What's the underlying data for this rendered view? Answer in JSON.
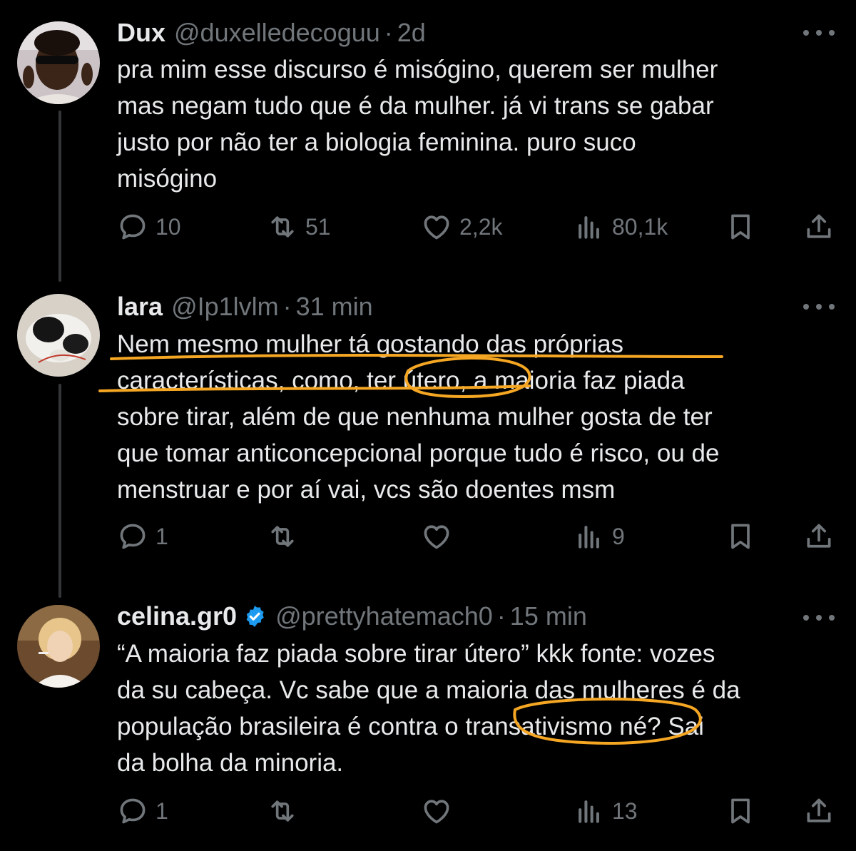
{
  "colors": {
    "background": "#000000",
    "text": "#e7e9ea",
    "muted": "#71767b",
    "verified": "#1d9bf0",
    "annotation": "#f5a623"
  },
  "tweets": [
    {
      "name": "Dux",
      "handle": "@duxelledecoguu",
      "separator": "·",
      "time": "2d",
      "verified": false,
      "text": "pra mim esse discurso é misógino, querem ser mulher\nmas negam tudo que é da mulher. já vi trans se gabar\njusto por não ter a biologia feminina. puro suco\nmisógino",
      "replies": "10",
      "reposts": "51",
      "likes": "2,2k",
      "views": "80,1k"
    },
    {
      "name": "lara",
      "handle": "@Ip1lvlm",
      "separator": "·",
      "time": "31 min",
      "verified": false,
      "text": "Nem mesmo mulher tá gostando das próprias\ncaracterísticas, como, ter útero, a maioria faz piada\nsobre tirar, além de que nenhuma mulher gosta de ter\nque tomar anticoncepcional porque tudo é risco, ou de\nmenstruar e por aí vai, vcs são doentes msm",
      "replies": "1",
      "reposts": "",
      "likes": "",
      "views": "9"
    },
    {
      "name": "celina.gr0",
      "handle": "@prettyhatemach0",
      "separator": "·",
      "time": "15 min",
      "verified": true,
      "text": "“A maioria faz piada sobre tirar útero” kkk fonte: vozes\nda su cabeça. Vc sabe que a maioria das mulheres é da\npopulação brasileira é contra o transativismo né? Sai\nda bolha da minoria.",
      "replies": "1",
      "reposts": "",
      "likes": "",
      "views": "13"
    }
  ],
  "icons": {
    "reply": "reply-icon",
    "repost": "repost-icon",
    "like": "heart-icon",
    "views": "views-icon",
    "bookmark": "bookmark-icon",
    "share": "share-icon",
    "more": "more-icon",
    "verified": "verified-badge-icon"
  }
}
